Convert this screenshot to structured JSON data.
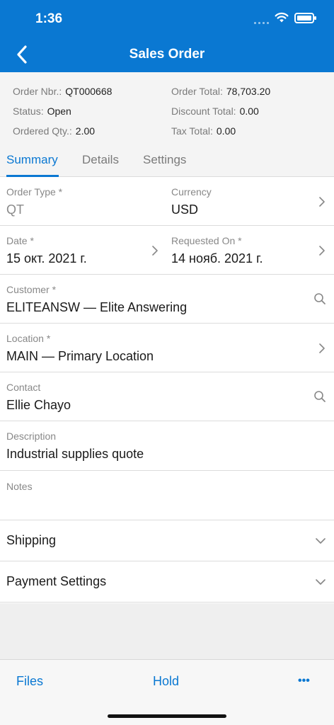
{
  "status_bar": {
    "time": "1:36"
  },
  "header": {
    "title": "Sales Order"
  },
  "summary": {
    "order_nbr_label": "Order Nbr.:",
    "order_nbr": "QT000668",
    "status_label": "Status:",
    "status": "Open",
    "ordered_qty_label": "Ordered Qty.:",
    "ordered_qty": "2.00",
    "order_total_label": "Order Total:",
    "order_total": "78,703.20",
    "discount_total_label": "Discount Total:",
    "discount_total": "0.00",
    "tax_total_label": "Tax Total:",
    "tax_total": "0.00"
  },
  "tabs": [
    "Summary",
    "Details",
    "Settings"
  ],
  "fields": {
    "order_type_label": "Order Type *",
    "order_type": "QT",
    "currency_label": "Currency",
    "currency": "USD",
    "date_label": "Date *",
    "date": "15 окт. 2021 г.",
    "requested_on_label": "Requested On *",
    "requested_on": "14 нояб. 2021 г.",
    "customer_label": "Customer *",
    "customer": "ELITEANSW — Elite Answering",
    "location_label": "Location *",
    "location": "MAIN — Primary Location",
    "contact_label": "Contact",
    "contact": "Ellie Chayo",
    "description_label": "Description",
    "description": "Industrial supplies quote",
    "notes_label": "Notes",
    "notes": ""
  },
  "sections": {
    "shipping": "Shipping",
    "payment_settings": "Payment Settings"
  },
  "bottom_bar": {
    "files": "Files",
    "hold": "Hold",
    "more": "•••"
  },
  "colors": {
    "accent": "#0a78d2",
    "background_gray": "#f4f4f4"
  }
}
